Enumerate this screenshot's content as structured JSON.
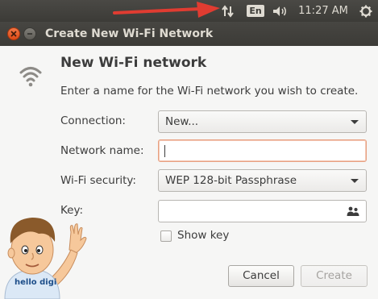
{
  "panel": {
    "keyboard_layout": "En",
    "clock": "11:27 AM",
    "icons": [
      "network-updown-icon",
      "volume-icon",
      "gear-icon"
    ]
  },
  "window": {
    "title": "Create New Wi-Fi Network"
  },
  "dialog": {
    "heading": "New Wi-Fi network",
    "description": "Enter a name for the Wi-Fi network you wish to create.",
    "connection": {
      "label": "Connection:",
      "value": "New..."
    },
    "network_name": {
      "label": "Network name:",
      "value": ""
    },
    "security": {
      "label": "Wi-Fi security:",
      "value": "WEP 128-bit Passphrase"
    },
    "key": {
      "label": "Key:",
      "value": ""
    },
    "show_key": {
      "label": "Show key",
      "checked": false
    },
    "buttons": {
      "cancel": "Cancel",
      "create": "Create"
    }
  },
  "watermark": {
    "text": "hello digi"
  },
  "colors": {
    "panel_bg": "#3c3b37",
    "close_button": "#df4a16",
    "annotation_arrow": "#e03c31",
    "focus_border": "#e8a081"
  }
}
